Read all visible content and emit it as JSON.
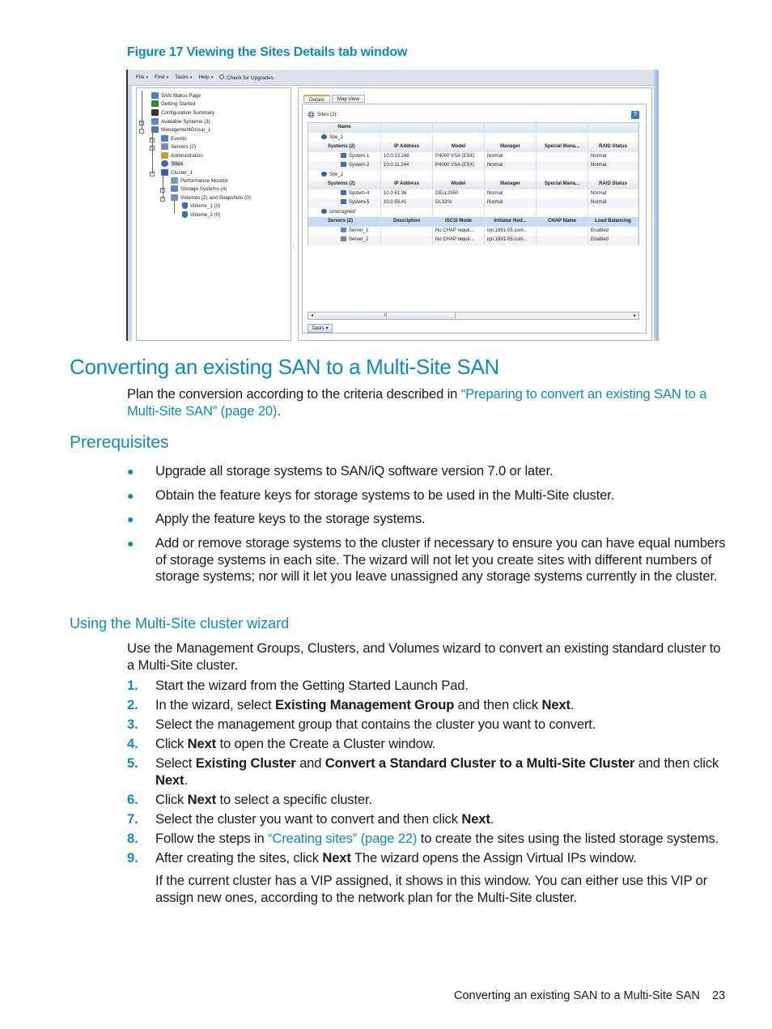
{
  "figure": {
    "caption": "Figure 17 Viewing the Sites Details tab window",
    "menubar": [
      {
        "label": "File",
        "caret": "▾"
      },
      {
        "label": "Find",
        "caret": "▾"
      },
      {
        "label": "Tasks",
        "caret": "▾"
      },
      {
        "label": "Help",
        "caret": "▾"
      },
      {
        "label": "Check for Upgrades",
        "caret": ""
      }
    ],
    "upgrade_icon": "upgrade-icon",
    "tree": [
      {
        "label": "SAN Status Page",
        "icon": "home-icon",
        "color": "#4a7fc1"
      },
      {
        "label": "Getting Started",
        "icon": "getting-started-icon",
        "color": "#2e8b3a"
      },
      {
        "label": "Configuration Summary",
        "icon": "sigma-icon",
        "color": "#333333"
      },
      {
        "label": "Available Systems (3)",
        "icon": "systems-icon",
        "color": "#5a8ac6"
      },
      {
        "label": "ManagementGroup_1",
        "icon": "management-group-icon",
        "color": "#4d74b8"
      },
      {
        "label": "Events",
        "icon": "events-icon",
        "color": "#4a7fc1"
      },
      {
        "label": "Servers (2)",
        "icon": "servers-icon",
        "color": "#7a8ea8"
      },
      {
        "label": "Administration",
        "icon": "administration-icon",
        "color": "#c9a227"
      },
      {
        "label": "Sites",
        "icon": "globe-icon",
        "color": "#3366aa"
      },
      {
        "label": "Cluster_1",
        "icon": "cluster-icon",
        "color": "#3a5fa8"
      },
      {
        "label": "Performance Monitor",
        "icon": "performance-monitor-icon",
        "color": "#7a9bc9"
      },
      {
        "label": "Storage Systems (4)",
        "icon": "storage-systems-icon",
        "color": "#5a8ac6"
      },
      {
        "label": "Volumes (2) and Snapshots (0)",
        "icon": "volumes-icon",
        "color": "#7a8ea8"
      },
      {
        "label": "Volume_1 (0)",
        "icon": "volume-icon",
        "color": "#3d6fb8"
      },
      {
        "label": "Volume_2 (0)",
        "icon": "volume-icon",
        "color": "#3d6fb8"
      }
    ],
    "tabs": [
      {
        "label": "Details",
        "active": true
      },
      {
        "label": "Map View",
        "active": false
      }
    ],
    "sites_label": "Sites (2):",
    "help_label": "?",
    "grid": {
      "columns": [
        "Name",
        "",
        "",
        "",
        "",
        ""
      ],
      "rows": [
        {
          "type": "site",
          "cells": [
            "Site_1",
            "",
            "",
            "",
            "",
            ""
          ]
        },
        {
          "type": "subheader",
          "cells": [
            "Systems (2)",
            "IP Address",
            "Model",
            "Manager",
            "Special Mana...",
            "RAID Status"
          ]
        },
        {
          "type": "system",
          "cells": [
            "System-1",
            "10.0.13.248",
            "P4000 VSA (ESX)",
            "Normal",
            "",
            "Normal"
          ]
        },
        {
          "type": "system",
          "cells": [
            "System-2",
            "10.0.11.244",
            "P4000 VSA (ESX)",
            "Normal",
            "",
            "Normal"
          ]
        },
        {
          "type": "site",
          "cells": [
            "Site_2",
            "",
            "",
            "",
            "",
            ""
          ]
        },
        {
          "type": "subheader",
          "cells": [
            "Systems (2)",
            "IP Address",
            "Model",
            "Manager",
            "Special Mana...",
            "RAID Status"
          ]
        },
        {
          "type": "system",
          "cells": [
            "System-4",
            "10.0.61.36",
            "DELL2950",
            "Normal",
            "",
            "Normal"
          ]
        },
        {
          "type": "system",
          "cells": [
            "System-5",
            "10.0.59.41",
            "DL320s",
            "Normal",
            "",
            "Normal"
          ]
        },
        {
          "type": "site-italic",
          "cells": [
            "Unassigned",
            "",
            "",
            "",
            "",
            ""
          ]
        },
        {
          "type": "selected-subheader",
          "cells": [
            "Servers (2)",
            "Description",
            "iSCSI Mode",
            "Initiator Nod...",
            "CHAP Name",
            "Load Balancing"
          ]
        },
        {
          "type": "server",
          "cells": [
            "Server_1",
            "",
            "No CHAP requir...",
            "iqn.1991-05.com...",
            "",
            "Enabled"
          ]
        },
        {
          "type": "server",
          "cells": [
            "Server_2",
            "",
            "No CHAP requir...",
            "iqn.1991-05.com...",
            "",
            "Enabled"
          ]
        }
      ]
    },
    "scroll_thumb_grip": "II",
    "scroll_left": "◂",
    "scroll_right": "▸",
    "tasks_button": "Tasks ▾"
  },
  "section": {
    "title": "Converting an existing SAN to a Multi-Site SAN",
    "intro_before_link": "Plan the conversion according to the criteria described in ",
    "intro_link": "“Preparing to convert an existing SAN to a Multi-Site SAN” (page 20)",
    "intro_after_link": ".",
    "prereq_title": "Prerequisites",
    "prereq_items": [
      "Upgrade all storage systems to SAN/iQ software version 7.0 or later.",
      "Obtain the feature keys for storage systems to be used in the Multi-Site cluster.",
      "Apply the feature keys to the storage systems.",
      "Add or remove storage systems to the cluster if necessary to ensure you can have equal numbers of storage systems in each site. The wizard will not let you create sites with different numbers of storage systems; nor will it let you leave unassigned any storage systems currently in the cluster."
    ],
    "wizard_title": "Using the Multi-Site cluster wizard",
    "wizard_intro": "Use the Management Groups, Clusters, and Volumes wizard to convert an existing standard cluster to a Multi-Site cluster.",
    "steps": {
      "s1": {
        "num": "1.",
        "text": "Start the wizard from the Getting Started Launch Pad."
      },
      "s2": {
        "num": "2.",
        "a": "In the wizard, select ",
        "b1": "Existing Management Group",
        "c": " and then click ",
        "b2": "Next",
        "d": "."
      },
      "s3": {
        "num": "3.",
        "text": "Select the management group that contains the cluster you want to convert."
      },
      "s4": {
        "num": "4.",
        "a": "Click ",
        "b1": "Next",
        "c": " to open the Create a Cluster window."
      },
      "s5": {
        "num": "5.",
        "a": "Select ",
        "b1": "Existing Cluster",
        "c": " and ",
        "b2": "Convert a Standard Cluster to a Multi-Site Cluster",
        "d": " and then click ",
        "b3": "Next",
        "e": "."
      },
      "s6": {
        "num": "6.",
        "a": "Click ",
        "b1": "Next",
        "c": " to select a specific cluster."
      },
      "s7": {
        "num": "7.",
        "a": "Select the cluster you want to convert and then click ",
        "b1": "Next",
        "c": "."
      },
      "s8": {
        "num": "8.",
        "a": "Follow the steps in ",
        "link": "“Creating sites” (page 22)",
        "c": " to create the sites using the listed storage systems."
      },
      "s9": {
        "num": "9.",
        "a": "After creating the sites, click ",
        "b1": "Next",
        "c": " The wizard opens the Assign Virtual IPs window."
      }
    },
    "vip_note": "If the current cluster has a VIP assigned, it shows in this window. You can either use this VIP or assign new ones, according to the network plan for the Multi-Site cluster."
  },
  "footer": {
    "running_title": "Converting an existing SAN to a Multi-Site SAN",
    "page_number": "23"
  }
}
